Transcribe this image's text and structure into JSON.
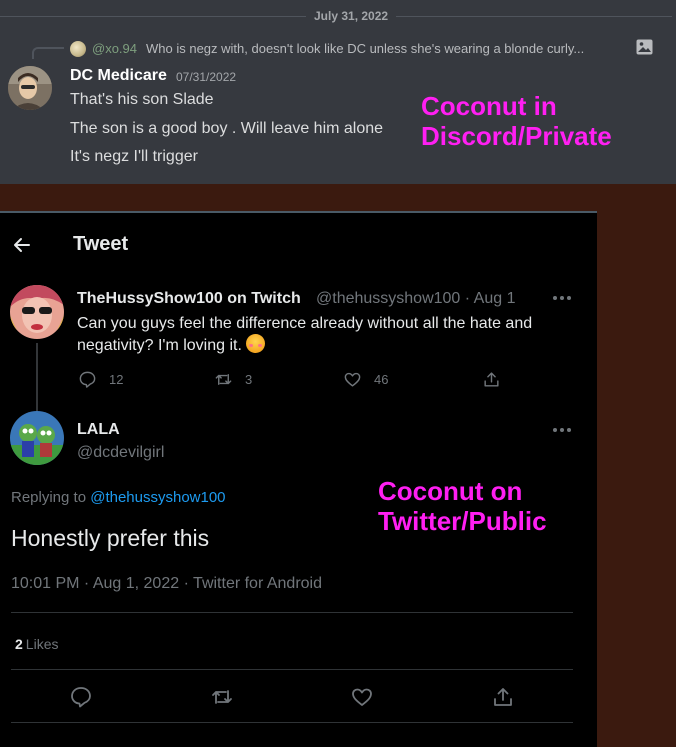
{
  "discord": {
    "date": "July 31, 2022",
    "reply": {
      "author": "@xo.94",
      "text": "Who is negz with, doesn't look like DC unless she's wearing a blonde curly..."
    },
    "author": "DC Medicare",
    "timestamp": "07/31/2022",
    "messages": [
      "That's his son Slade",
      "The son is a good boy . Will leave him alone",
      "It's negz I'll trigger"
    ],
    "caption_lines": [
      "Coconut in",
      "Discord/Private"
    ],
    "icons": {
      "reply_avatar": "avatar",
      "image": "image-icon",
      "author_avatar": "avatar"
    }
  },
  "twitter": {
    "title": "Tweet",
    "back_icon": "arrow-left-icon",
    "parent": {
      "name": "TheHussyShow100 on Twitch",
      "handle_line": "@thehussyshow100 · Aug 1",
      "text": "Can you guys feel the difference already without all the hate and negativity? I'm loving it.",
      "emoji": "smiling-face-with-hearts",
      "replies": "12",
      "retweets": "3",
      "likes": "46"
    },
    "reply": {
      "name": "LALA",
      "handle": "@dcdevilgirl",
      "replying_prefix": "Replying to ",
      "replying_to": "@thehussyshow100",
      "text": "Honestly prefer this",
      "meta": "10:01 PM · Aug 1, 2022 · Twitter for Android",
      "like_count": "2",
      "like_label": "Likes"
    },
    "caption_lines": [
      "Coconut on",
      "Twitter/Public"
    ],
    "colors": {
      "link": "#1d9bf0",
      "caption": "#ff1ff2"
    }
  }
}
